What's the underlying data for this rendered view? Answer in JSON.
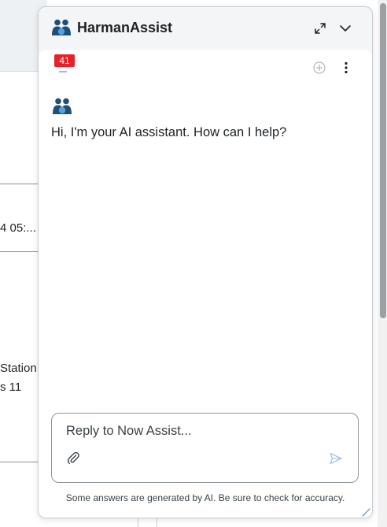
{
  "background": {
    "row_texts": [
      "4 05:...",
      "Station",
      "s 11"
    ]
  },
  "panel": {
    "title": "HarmanAssist",
    "header_icons": [
      "expand-icon",
      "chevron-down-icon"
    ],
    "history_badge_count": "41",
    "toolbar_icons": [
      "new-chat-icon",
      "more-vertical-icon"
    ]
  },
  "chat": {
    "greeting": "Hi, I'm your AI assistant. How can I help?"
  },
  "composer": {
    "placeholder": "Reply to Now Assist...",
    "value": "",
    "icons": [
      "paperclip-icon",
      "send-icon"
    ]
  },
  "footer": {
    "disclaimer": "Some answers are generated by AI. Be sure to check for accuracy."
  },
  "colors": {
    "brand_blue": "#1f4e79",
    "badge_red": "#e8202a",
    "panel_bg": "#f4f5f6",
    "text": "#1d2226"
  }
}
